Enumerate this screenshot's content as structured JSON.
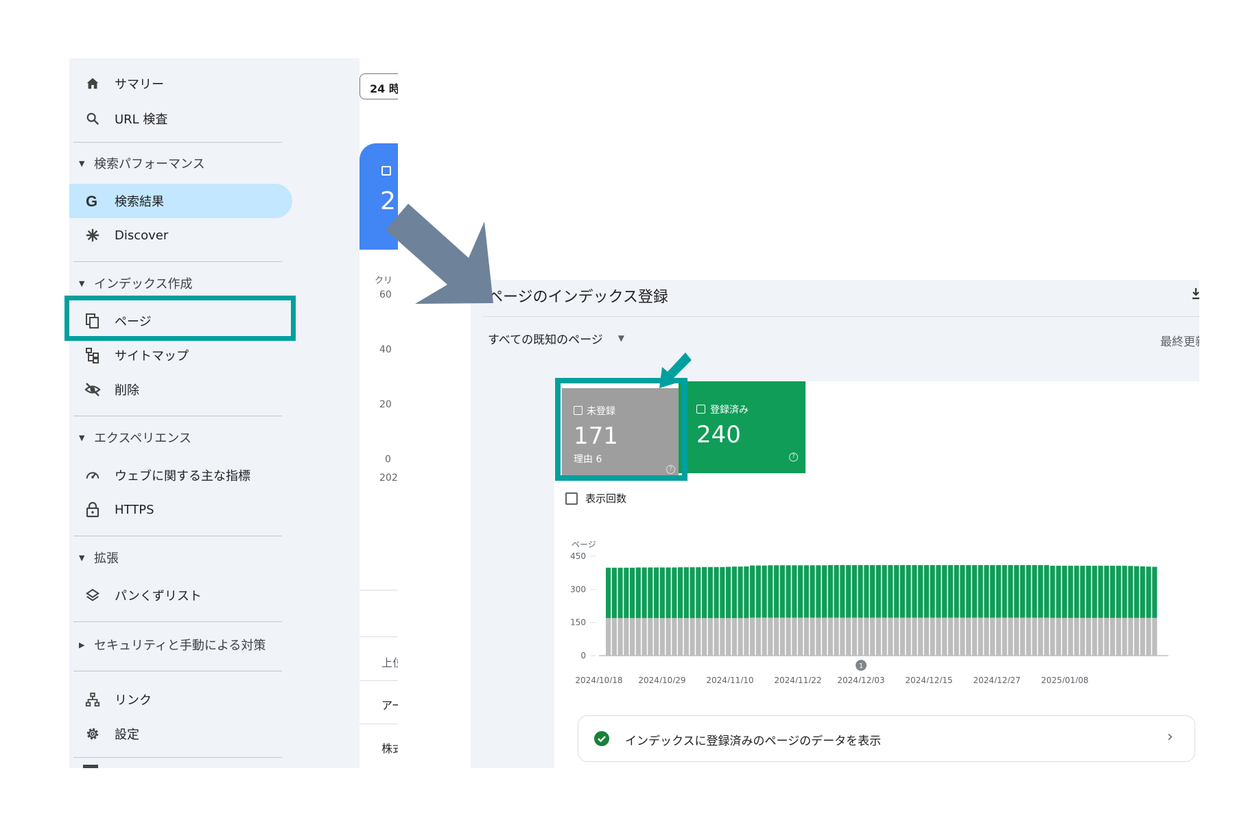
{
  "sidebar": {
    "summary": "サマリー",
    "url_inspection": "URL 検査",
    "performance_section": "検索パフォーマンス",
    "search_results": "検索結果",
    "discover": "Discover",
    "indexing_section": "インデックス作成",
    "pages": "ページ",
    "sitemaps": "サイトマップ",
    "removals": "削除",
    "experience_section": "エクスペリエンス",
    "core_web_vitals": "ウェブに関する主な指標",
    "https": "HTTPS",
    "enhancements_section": "拡張",
    "breadcrumbs": "パンくずリスト",
    "security_section": "セキュリティと手動による対策",
    "links": "リンク",
    "settings": "設定"
  },
  "background": {
    "date_chip": "24 時",
    "card_value": "2",
    "clicks_label": "クリ",
    "y_ticks": [
      "60",
      "40",
      "20",
      "0"
    ],
    "x_label": "202",
    "row1": "上位",
    "row2": "アー",
    "row3": "株式"
  },
  "panel": {
    "title": "ページのインデックス登録",
    "filter": "すべての既知のページ",
    "last_updated": "最終更新",
    "not_indexed": {
      "label": "未登録",
      "value": "171",
      "sub": "理由 6",
      "color": "#9e9e9e"
    },
    "indexed": {
      "label": "登録済み",
      "value": "240",
      "color": "#0f9d58"
    },
    "impressions_label": "表示回数",
    "view_indexed_data": "インデックスに登録済みのページのデータを表示",
    "annotation_marker": "1"
  },
  "chart_data": {
    "type": "bar",
    "stacked": true,
    "ylabel": "ページ",
    "ylim": [
      0,
      450
    ],
    "y_ticks": [
      "450",
      "300",
      "150",
      "0"
    ],
    "x_ticks": [
      "2024/10/18",
      "2024/10/29",
      "2024/11/10",
      "2024/11/22",
      "2024/12/03",
      "2024/12/15",
      "2024/12/27",
      "2025/01/08"
    ],
    "series": [
      {
        "name": "未登録",
        "color": "#bdbdbd",
        "values": [
          170,
          170,
          170,
          170,
          170,
          170,
          170,
          170,
          170,
          170,
          170,
          170,
          170,
          170,
          170,
          170,
          170,
          170,
          170,
          170,
          170,
          170,
          170,
          170,
          172,
          172,
          172,
          172,
          172,
          172,
          172,
          172,
          172,
          172,
          172,
          172,
          172,
          172,
          172,
          172,
          172,
          172,
          172,
          172,
          172,
          172,
          172,
          172,
          172,
          172,
          172,
          172,
          172,
          172,
          172,
          172,
          172,
          172,
          172,
          172,
          172,
          172,
          172,
          172,
          172,
          172,
          172,
          172,
          172,
          172,
          172,
          172,
          172,
          172,
          171,
          171,
          171,
          171,
          171,
          171,
          171,
          171,
          171,
          171,
          171,
          171,
          171,
          171,
          171,
          171,
          171,
          171
        ]
      },
      {
        "name": "登録済み",
        "color": "#0f9d58",
        "values": [
          228,
          228,
          228,
          228,
          228,
          229,
          229,
          229,
          229,
          229,
          229,
          229,
          230,
          230,
          230,
          230,
          231,
          231,
          231,
          231,
          232,
          233,
          233,
          234,
          236,
          236,
          236,
          237,
          237,
          237,
          237,
          237,
          237,
          237,
          237,
          237,
          237,
          238,
          238,
          238,
          238,
          238,
          238,
          238,
          238,
          238,
          238,
          238,
          238,
          238,
          238,
          238,
          238,
          238,
          238,
          238,
          238,
          238,
          238,
          238,
          238,
          238,
          238,
          238,
          238,
          238,
          238,
          238,
          238,
          238,
          238,
          238,
          238,
          238,
          236,
          236,
          236,
          236,
          236,
          236,
          236,
          236,
          236,
          236,
          236,
          236,
          236,
          235,
          234,
          233,
          232,
          231
        ]
      }
    ]
  },
  "annotations": {
    "big_arrow_color": "#6e8399",
    "highlight_color": "#00a09e"
  }
}
